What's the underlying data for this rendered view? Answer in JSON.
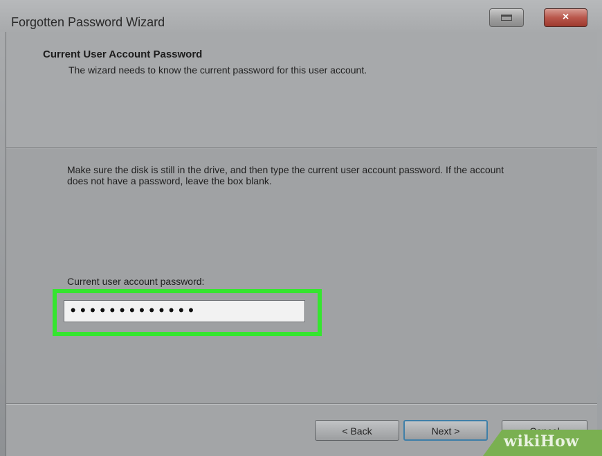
{
  "window": {
    "title": "Forgotten Password Wizard",
    "close_glyph": "×"
  },
  "header": {
    "title": "Current User Account Password",
    "subtitle": "The wizard needs to know the current password for this user account."
  },
  "body": {
    "instructions": "Make sure the disk is still in the drive, and then type the current user account password. If the account does not have a password, leave the box blank.",
    "password_label": "Current user account password:",
    "password_value": "•••••••••••••"
  },
  "buttons": {
    "back": "< Back",
    "next": "Next >",
    "cancel": "Cancel"
  },
  "watermark": "wikiHow",
  "colors": {
    "highlight": "#35e52f",
    "close_button": "#b9574c",
    "watermark_bg": "#7ab051"
  }
}
